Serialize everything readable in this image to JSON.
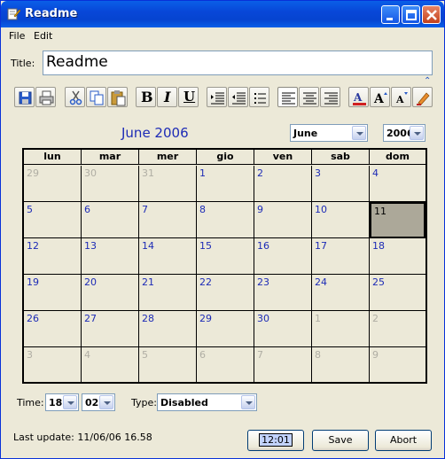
{
  "window": {
    "title": "Readme"
  },
  "menu": {
    "items": [
      "File",
      "Edit"
    ]
  },
  "form": {
    "title_label": "Title:",
    "title_value": "Readme"
  },
  "toolbar": {
    "buttons": [
      "save-icon",
      "print-icon",
      "cut-icon",
      "copy-icon",
      "paste-icon",
      "bold-icon",
      "italic-icon",
      "underline-icon",
      "indent-icon",
      "outdent-icon",
      "bullet-list-icon",
      "align-left-icon",
      "align-center-icon",
      "align-right-icon",
      "font-color-icon",
      "font-grow-icon",
      "font-shrink-icon",
      "clear-format-icon"
    ],
    "bold": "B",
    "italic": "I",
    "underline": "U",
    "collapse_glyph": "⌃"
  },
  "calendar": {
    "title": "June 2006",
    "month_select": "June",
    "year_select": "2006",
    "weekdays": [
      "lun",
      "mar",
      "mer",
      "gio",
      "ven",
      "sab",
      "dom"
    ],
    "weeks": [
      [
        {
          "d": "29",
          "o": true
        },
        {
          "d": "30",
          "o": true
        },
        {
          "d": "31",
          "o": true
        },
        {
          "d": "1"
        },
        {
          "d": "2"
        },
        {
          "d": "3"
        },
        {
          "d": "4"
        }
      ],
      [
        {
          "d": "5"
        },
        {
          "d": "6"
        },
        {
          "d": "7"
        },
        {
          "d": "8"
        },
        {
          "d": "9"
        },
        {
          "d": "10"
        },
        {
          "d": "11",
          "today": true
        }
      ],
      [
        {
          "d": "12"
        },
        {
          "d": "13"
        },
        {
          "d": "14"
        },
        {
          "d": "15"
        },
        {
          "d": "16"
        },
        {
          "d": "17"
        },
        {
          "d": "18"
        }
      ],
      [
        {
          "d": "19"
        },
        {
          "d": "20"
        },
        {
          "d": "21"
        },
        {
          "d": "22"
        },
        {
          "d": "23"
        },
        {
          "d": "24"
        },
        {
          "d": "25"
        }
      ],
      [
        {
          "d": "26"
        },
        {
          "d": "27"
        },
        {
          "d": "28"
        },
        {
          "d": "29"
        },
        {
          "d": "30"
        },
        {
          "d": "1",
          "o": true
        },
        {
          "d": "2",
          "o": true
        }
      ],
      [
        {
          "d": "3",
          "o": true
        },
        {
          "d": "4",
          "o": true
        },
        {
          "d": "5",
          "o": true
        },
        {
          "d": "6",
          "o": true
        },
        {
          "d": "7",
          "o": true
        },
        {
          "d": "8",
          "o": true
        },
        {
          "d": "9",
          "o": true
        }
      ]
    ]
  },
  "time": {
    "label": "Time:",
    "hour": "18",
    "minute": "02",
    "type_label": "Type:",
    "type_value": "Disabled"
  },
  "footer": {
    "last_update": "Last update: 11/06/06 16.58",
    "clock_button": "12:01",
    "save_button": "Save",
    "abort_button": "Abort"
  },
  "colors": {
    "title_bar": "#0a5fe8",
    "calendar_date": "#1d2bb6",
    "today_bg": "#aca899",
    "window_bg": "#ece9d8"
  }
}
